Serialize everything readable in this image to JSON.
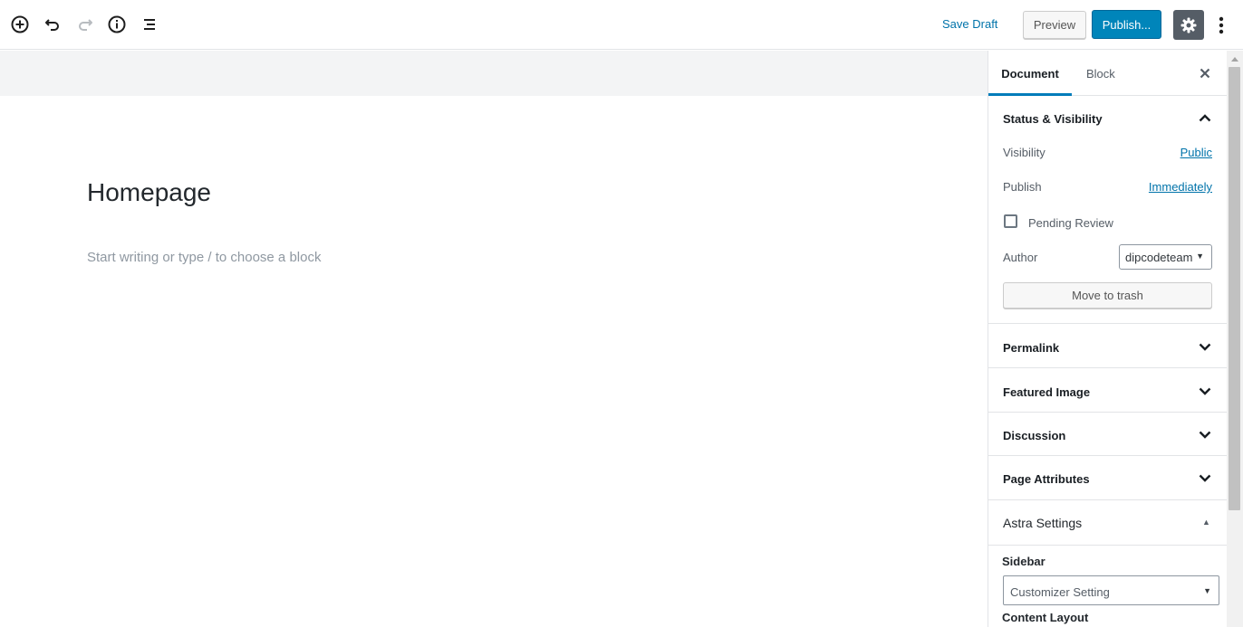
{
  "toolbar": {
    "save_draft": "Save Draft",
    "preview": "Preview",
    "publish": "Publish...",
    "icons": [
      "add-block-icon",
      "undo-icon",
      "redo-icon",
      "info-icon",
      "outline-icon",
      "gear-icon",
      "more-vertical-icon"
    ]
  },
  "editor": {
    "title": "Homepage",
    "placeholder": "Start writing or type / to choose a block"
  },
  "sidebar": {
    "tabs": [
      {
        "label": "Document",
        "active": true
      },
      {
        "label": "Block",
        "active": false
      }
    ],
    "status_visibility": {
      "title": "Status & Visibility",
      "visibility_label": "Visibility",
      "visibility_value": "Public",
      "publish_label": "Publish",
      "publish_value": "Immediately",
      "pending_review_label": "Pending Review",
      "pending_review_checked": false,
      "author_label": "Author",
      "author_value": "dipcodeteam",
      "move_to_trash": "Move to trash"
    },
    "panels": [
      {
        "title": "Permalink"
      },
      {
        "title": "Featured Image"
      },
      {
        "title": "Discussion"
      },
      {
        "title": "Page Attributes"
      }
    ],
    "astra": {
      "title": "Astra Settings",
      "sidebar_label": "Sidebar",
      "sidebar_value": "Customizer Setting",
      "content_layout_label": "Content Layout"
    }
  },
  "colors": {
    "accent": "#0085ba",
    "link": "#0073aa",
    "settings_active": "#555d66",
    "tab_indicator": "#007cba"
  }
}
